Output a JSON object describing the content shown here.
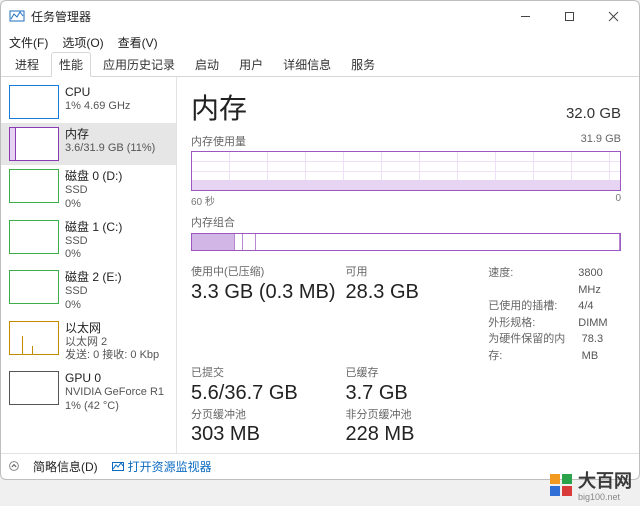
{
  "window": {
    "title": "任务管理器"
  },
  "menubar": {
    "file": "文件(F)",
    "options": "选项(O)",
    "view": "查看(V)"
  },
  "tabs": {
    "processes": "进程",
    "performance": "性能",
    "app_history": "应用历史记录",
    "startup": "启动",
    "users": "用户",
    "details": "详细信息",
    "services": "服务"
  },
  "sidebar": [
    {
      "title": "CPU",
      "line2": "1%  4.69 GHz",
      "line3": ""
    },
    {
      "title": "内存",
      "line2": "3.6/31.9 GB (11%)",
      "line3": ""
    },
    {
      "title": "磁盘 0 (D:)",
      "line2": "SSD",
      "line3": "0%"
    },
    {
      "title": "磁盘 1 (C:)",
      "line2": "SSD",
      "line3": "0%"
    },
    {
      "title": "磁盘 2 (E:)",
      "line2": "SSD",
      "line3": "0%"
    },
    {
      "title": "以太网",
      "line2": "以太网 2",
      "line3": "发送: 0  接收: 0 Kbp"
    },
    {
      "title": "GPU 0",
      "line2": "NVIDIA GeForce R1",
      "line3": "1%  (42 °C)"
    }
  ],
  "memory": {
    "heading": "内存",
    "total": "32.0 GB",
    "usage_label": "内存使用量",
    "usage_max": "31.9 GB",
    "xaxis_left": "60 秒",
    "xaxis_right": "0",
    "comp_label": "内存组合",
    "stats": {
      "in_use_label": "使用中(已压缩)",
      "in_use_value": "3.3 GB (0.3 MB)",
      "available_label": "可用",
      "available_value": "28.3 GB",
      "committed_label": "已提交",
      "committed_value": "5.6/36.7 GB",
      "cached_label": "已缓存",
      "cached_value": "3.7 GB",
      "paged_label": "分页缓冲池",
      "paged_value": "303 MB",
      "nonpaged_label": "非分页缓冲池",
      "nonpaged_value": "228 MB"
    },
    "specs": {
      "speed_k": "速度:",
      "speed_v": "3800 MHz",
      "slots_k": "已使用的插槽:",
      "slots_v": "4/4",
      "form_k": "外形规格:",
      "form_v": "DIMM",
      "hw_k": "为硬件保留的内存:",
      "hw_v": "78.3 MB"
    }
  },
  "footer": {
    "brief": "简略信息(D)",
    "resmon": "打开资源监视器"
  },
  "watermark": {
    "big": "大百网",
    "sub": "big100.net"
  },
  "chart_data": {
    "type": "line",
    "title": "内存使用量",
    "xlabel": "秒",
    "x_range_sec": [
      60,
      0
    ],
    "ylabel": "GB",
    "ylim": [
      0,
      31.9
    ],
    "series": [
      {
        "name": "使用中",
        "approx_constant_gb": 3.6
      }
    ],
    "composition_gb": {
      "in_use": 3.3,
      "cached": 3.7,
      "available": 24.9,
      "total": 31.9
    }
  }
}
